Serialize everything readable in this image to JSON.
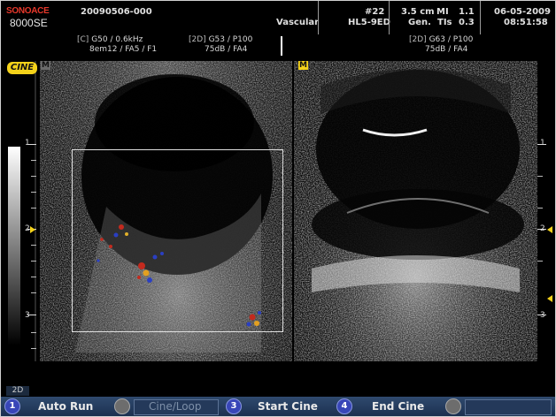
{
  "header": {
    "brand_top": "SONOACE",
    "brand_bottom": "8000SE",
    "patient_id": "20090506-000",
    "application": "Vascular",
    "preset_number": "#22",
    "probe": "HL5-9ED",
    "depth": "3.5 cm",
    "mode": "Gen.",
    "mi_label": "MI",
    "mi_value": "1.1",
    "tis_label": "TIs",
    "tis_value": "0.3",
    "date": "06-05-2009",
    "time": "08:51:58"
  },
  "left_params": {
    "color_line1_tag": "[C]",
    "color_line1": "G50 / 0.6kHz",
    "color_line2": "8em12 / FA5 / F1",
    "bmode_line1_tag": "[2D]",
    "bmode_line1": "G53 / P100",
    "bmode_line2": "75dB / FA4"
  },
  "right_params": {
    "line1_tag": "[2D]",
    "line1": "G63 / P100",
    "line2": "75dB / FA4"
  },
  "cine_badge": "CINE",
  "left_indicator": "M",
  "right_indicator": "M",
  "scale": {
    "left_labels": [
      "1",
      "2",
      "3"
    ],
    "right_labels": [
      "1",
      "2",
      "3"
    ]
  },
  "mode_tab": "2D",
  "softkeys": [
    {
      "num": "1",
      "label": "Auto Run",
      "enabled": true
    },
    {
      "num": "",
      "label": "Cine/Loop",
      "enabled": false
    },
    {
      "num": "3",
      "label": "Start Cine",
      "enabled": true
    },
    {
      "num": "4",
      "label": "End Cine",
      "enabled": true
    },
    {
      "num": "",
      "label": "",
      "enabled": false
    }
  ],
  "colors": {
    "accent_yellow": "#f4d21a",
    "brand_red": "#e8382b",
    "softbar_blue": "#2f4a6e",
    "key_blue": "#3846b8"
  }
}
